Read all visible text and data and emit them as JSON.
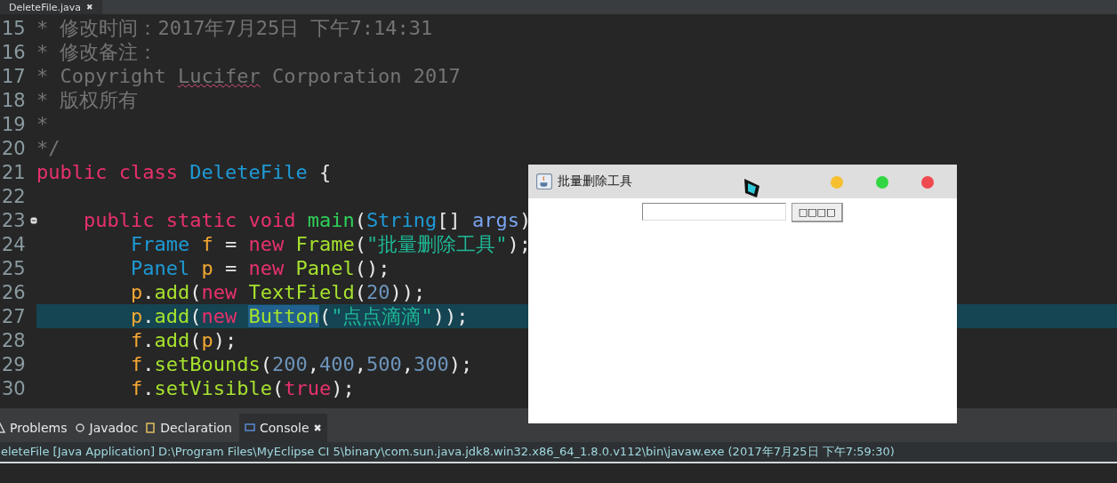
{
  "editor_tab": {
    "label": "DeleteFile.java",
    "close": "✖"
  },
  "code_lines": [
    {
      "number": "15",
      "highlighted": false,
      "tokens": [
        {
          "text": "* 修改时间：2017年7月25日 下午7:14:31",
          "kind": "comment"
        }
      ]
    },
    {
      "number": "16",
      "highlighted": false,
      "tokens": [
        {
          "text": "* 修改备注：",
          "kind": "comment"
        }
      ]
    },
    {
      "number": "17",
      "highlighted": false,
      "tokens": [
        {
          "text": "* Copyright ",
          "kind": "comment"
        },
        {
          "text": "Lucifer",
          "kind": "comment-misspelled"
        },
        {
          "text": " Corporation 2017",
          "kind": "comment"
        }
      ]
    },
    {
      "number": "18",
      "highlighted": false,
      "tokens": [
        {
          "text": "* 版权所有",
          "kind": "comment"
        }
      ]
    },
    {
      "number": "19",
      "highlighted": false,
      "tokens": [
        {
          "text": "*",
          "kind": "comment"
        }
      ]
    },
    {
      "number": "20",
      "highlighted": false,
      "tokens": [
        {
          "text": "*/",
          "kind": "comment"
        }
      ]
    },
    {
      "number": "21",
      "highlighted": false,
      "tokens": [
        {
          "text": "public class ",
          "kind": "keyword"
        },
        {
          "text": "DeleteFile",
          "kind": "type"
        },
        {
          "text": " {",
          "kind": "plain"
        }
      ]
    },
    {
      "number": "22",
      "highlighted": false
    },
    {
      "number": "23",
      "highlighted": false,
      "folding": true,
      "tokens": [
        {
          "text": "    public static void ",
          "kind": "keyword"
        },
        {
          "text": "main",
          "kind": "declaration"
        },
        {
          "text": "(",
          "kind": "plain"
        },
        {
          "text": "String",
          "kind": "type"
        },
        {
          "text": "[] ",
          "kind": "plain"
        },
        {
          "text": "args",
          "kind": "parameter"
        },
        {
          "text": ")",
          "kind": "plain"
        }
      ]
    },
    {
      "number": "24",
      "highlighted": false,
      "tokens": [
        {
          "text": "        Frame ",
          "kind": "type"
        },
        {
          "text": "f",
          "kind": "variable"
        },
        {
          "text": " = ",
          "kind": "plain"
        },
        {
          "text": "new ",
          "kind": "keyword"
        },
        {
          "text": "Frame",
          "kind": "method"
        },
        {
          "text": "(",
          "kind": "plain"
        },
        {
          "text": "\"批量删除工具\"",
          "kind": "string"
        },
        {
          "text": ");",
          "kind": "plain"
        }
      ]
    },
    {
      "number": "25",
      "highlighted": false,
      "tokens": [
        {
          "text": "        Panel ",
          "kind": "type"
        },
        {
          "text": "p",
          "kind": "variable"
        },
        {
          "text": " = ",
          "kind": "plain"
        },
        {
          "text": "new ",
          "kind": "keyword"
        },
        {
          "text": "Panel",
          "kind": "method"
        },
        {
          "text": "();",
          "kind": "plain"
        }
      ]
    },
    {
      "number": "26",
      "highlighted": false,
      "tokens": [
        {
          "text": "        p",
          "kind": "variable"
        },
        {
          "text": ".",
          "kind": "plain"
        },
        {
          "text": "add",
          "kind": "method"
        },
        {
          "text": "(",
          "kind": "plain"
        },
        {
          "text": "new ",
          "kind": "keyword"
        },
        {
          "text": "TextField",
          "kind": "method"
        },
        {
          "text": "(",
          "kind": "plain"
        },
        {
          "text": "20",
          "kind": "number"
        },
        {
          "text": "));",
          "kind": "plain"
        }
      ]
    },
    {
      "number": "27",
      "highlighted": true,
      "tokens": [
        {
          "text": "        p",
          "kind": "variable"
        },
        {
          "text": ".",
          "kind": "plain"
        },
        {
          "text": "add",
          "kind": "method"
        },
        {
          "text": "(",
          "kind": "plain"
        },
        {
          "text": "new ",
          "kind": "keyword"
        },
        {
          "text": "Button",
          "kind": "selection"
        },
        {
          "text": "(",
          "kind": "plain"
        },
        {
          "text": "\"点点滴滴\"",
          "kind": "string"
        },
        {
          "text": "));",
          "kind": "plain"
        }
      ]
    },
    {
      "number": "28",
      "highlighted": false,
      "tokens": [
        {
          "text": "        f",
          "kind": "variable"
        },
        {
          "text": ".",
          "kind": "plain"
        },
        {
          "text": "add",
          "kind": "method"
        },
        {
          "text": "(",
          "kind": "plain"
        },
        {
          "text": "p",
          "kind": "variable"
        },
        {
          "text": ");",
          "kind": "plain"
        }
      ]
    },
    {
      "number": "29",
      "highlighted": false,
      "tokens": [
        {
          "text": "        f",
          "kind": "variable"
        },
        {
          "text": ".",
          "kind": "plain"
        },
        {
          "text": "setBounds",
          "kind": "method"
        },
        {
          "text": "(",
          "kind": "plain"
        },
        {
          "text": "200",
          "kind": "number"
        },
        {
          "text": ",",
          "kind": "plain"
        },
        {
          "text": "400",
          "kind": "number"
        },
        {
          "text": ",",
          "kind": "plain"
        },
        {
          "text": "500",
          "kind": "number"
        },
        {
          "text": ",",
          "kind": "plain"
        },
        {
          "text": "300",
          "kind": "number"
        },
        {
          "text": ");",
          "kind": "plain"
        }
      ]
    },
    {
      "number": "30",
      "highlighted": false,
      "tokens": [
        {
          "text": "        f",
          "kind": "variable"
        },
        {
          "text": ".",
          "kind": "plain"
        },
        {
          "text": "setVisible",
          "kind": "method"
        },
        {
          "text": "(",
          "kind": "plain"
        },
        {
          "text": "true",
          "kind": "keyword"
        },
        {
          "text": ");",
          "kind": "plain"
        }
      ]
    }
  ],
  "panel_tabs": [
    {
      "label": "Problems",
      "selected": false
    },
    {
      "label": "Javadoc",
      "selected": false
    },
    {
      "label": "Declaration",
      "selected": false
    },
    {
      "label": "Console",
      "selected": true,
      "close": "✖"
    }
  ],
  "console_status": "eleteFile [Java Application] D:\\Program Files\\MyEclipse CI 5\\binary\\com.sun.java.jdk8.win32.x86_64_1.8.0.v112\\bin\\javaw.exe (2017年7月25日 下午7:59:30)",
  "app_window": {
    "title": "批量删除工具",
    "button": "□□□□"
  }
}
